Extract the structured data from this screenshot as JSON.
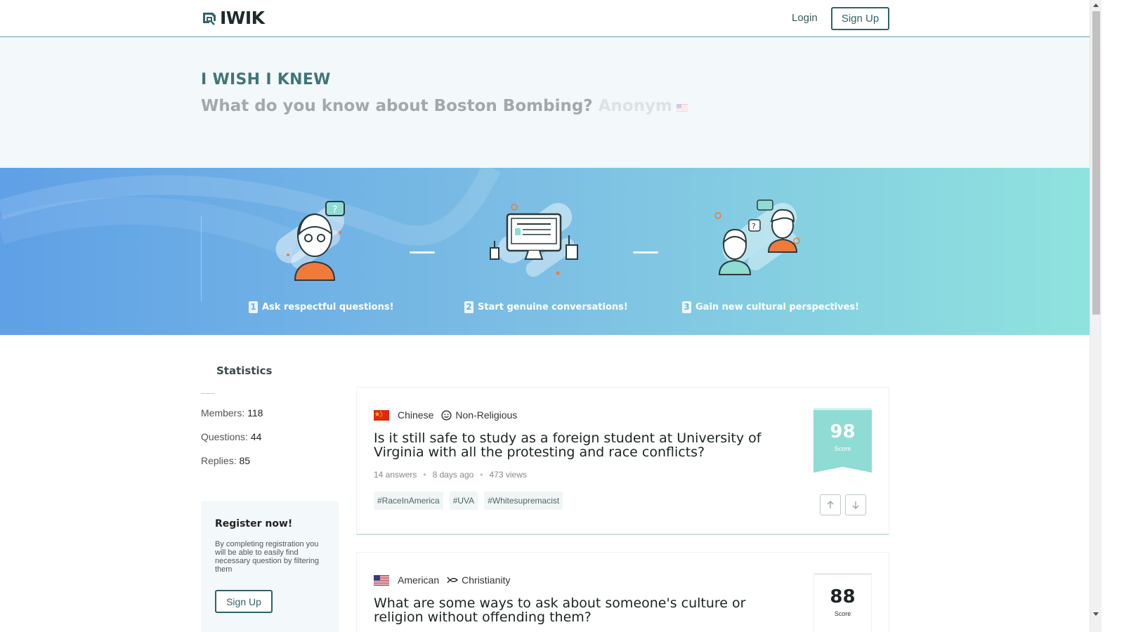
{
  "header": {
    "logo_text": "IWIK",
    "login_label": "Login",
    "signup_label": "Sign Up"
  },
  "hero": {
    "title": "I WISH I KNEW",
    "question": "What do you know about Boston Bombing?",
    "ghost_text": "Anonym"
  },
  "banner": {
    "steps": [
      {
        "num": "1",
        "label": "Ask respectful questions!"
      },
      {
        "num": "2",
        "label": "Start genuine conversations!"
      },
      {
        "num": "3",
        "label": "Gain new cultural perspectives!"
      }
    ]
  },
  "sidebar": {
    "statistics_title": "Statistics",
    "members_label": "Members:",
    "members_value": "118",
    "questions_label": "Questions:",
    "questions_value": "44",
    "replies_label": "Replies:",
    "replies_value": "85",
    "register_title": "Register now!",
    "register_text": "By completing registration you will be able to easily find necessary question by filtering them",
    "register_button": "Sign Up"
  },
  "questions": [
    {
      "nationality": "Chinese",
      "flag_icon": "china-flag-icon",
      "religion": "Non-Religious",
      "religion_icon": "smiley-icon",
      "title": "Is it still safe to study as a foreign student at University of Virginia with all the protesting and race conflicts?",
      "answers": "14 answers",
      "time": "8 days ago",
      "views": "473 views",
      "tags": [
        "#RaceInAmerica",
        "#UVA",
        "#Whitesupremacist"
      ],
      "score": "98",
      "score_label": "Score",
      "accent": "#8edcd3"
    },
    {
      "nationality": "American",
      "flag_icon": "usa-flag-icon",
      "religion": "Christianity",
      "religion_icon": "ichthys-icon",
      "title": "What are some ways to ask about someone's culture or religion without offending them?",
      "score": "88",
      "score_label": "Score"
    }
  ]
}
